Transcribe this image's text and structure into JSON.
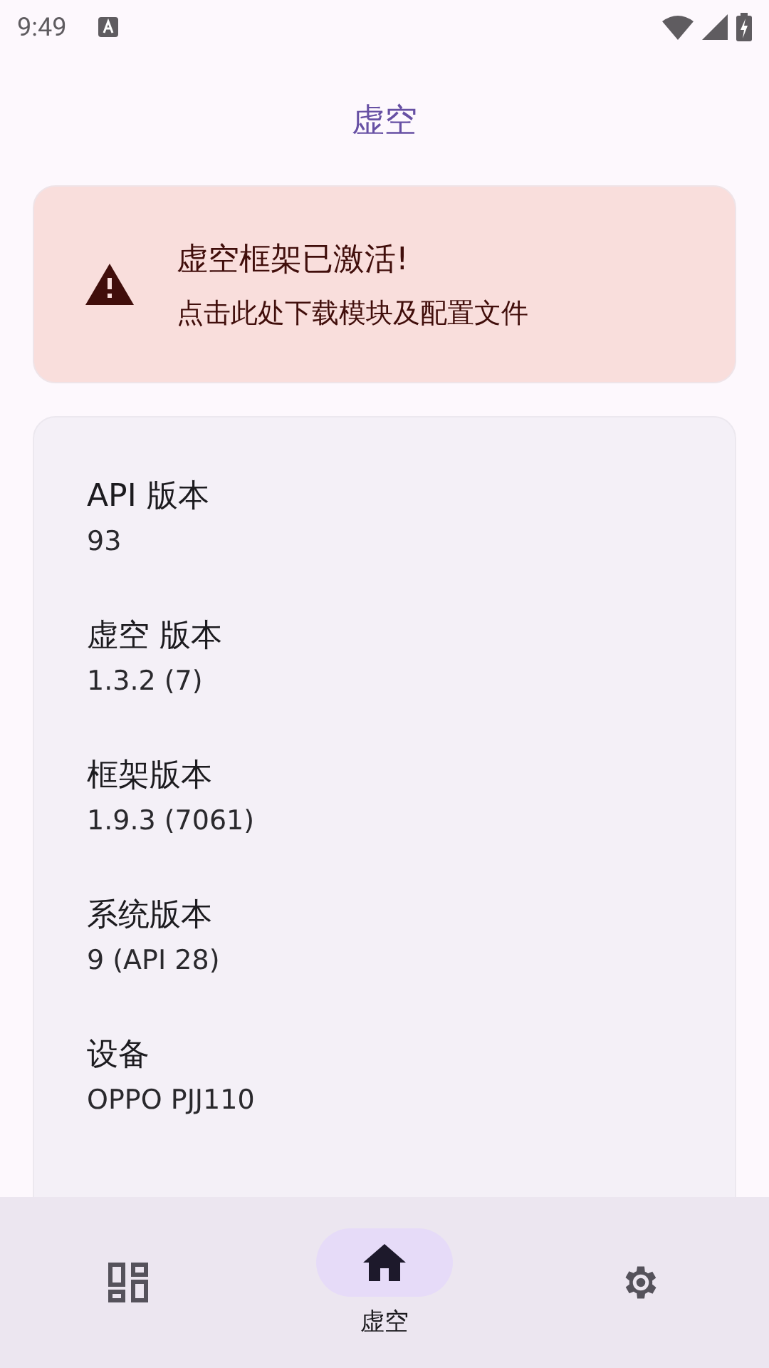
{
  "status_bar": {
    "time": "9:49"
  },
  "app_bar": {
    "title": "虚空"
  },
  "banner": {
    "title": "虚空框架已激活!",
    "subtitle": "点击此处下载模块及配置文件"
  },
  "info": [
    {
      "label": "API 版本",
      "value": "93"
    },
    {
      "label": "虚空 版本",
      "value": "1.3.2 (7)"
    },
    {
      "label": "框架版本",
      "value": "1.9.3 (7061)"
    },
    {
      "label": "系统版本",
      "value": "9 (API 28)"
    },
    {
      "label": "设备",
      "value": "OPPO PJJ110"
    }
  ],
  "bottom_nav": [
    {
      "kind": "dashboard",
      "selected": false
    },
    {
      "kind": "home",
      "label": "虚空",
      "selected": true
    },
    {
      "kind": "settings",
      "selected": false
    }
  ]
}
